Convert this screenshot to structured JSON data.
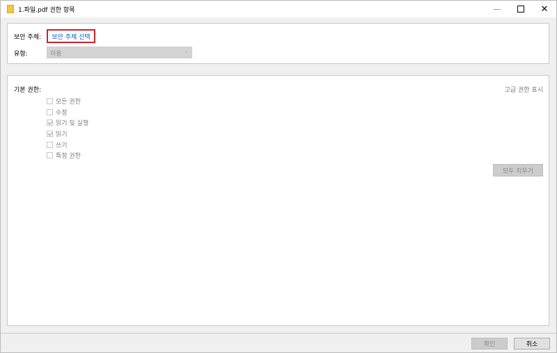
{
  "window": {
    "title": "1.파일.pdf 권한 항목",
    "controls": {
      "minimize": "—",
      "maximize": "☐",
      "close": "✕"
    }
  },
  "principal": {
    "label": "보안 주체:",
    "link": "보안 주체 선택"
  },
  "type": {
    "label": "유형:",
    "value": "허용"
  },
  "permissions": {
    "heading": "기본 권한:",
    "advanced_link": "고급 권한 표시",
    "items": [
      {
        "label": "모든 권한",
        "checked": false
      },
      {
        "label": "수정",
        "checked": false
      },
      {
        "label": "읽기 및 실행",
        "checked": true
      },
      {
        "label": "읽기",
        "checked": true
      },
      {
        "label": "쓰기",
        "checked": false
      },
      {
        "label": "특정 권한",
        "checked": false
      }
    ],
    "clear_all": "모두 지우기"
  },
  "footer": {
    "ok": "확인",
    "cancel": "취소"
  },
  "colors": {
    "highlight_border": "#c8232c",
    "link": "#0066cc",
    "folder_icon": "#f5c644"
  }
}
